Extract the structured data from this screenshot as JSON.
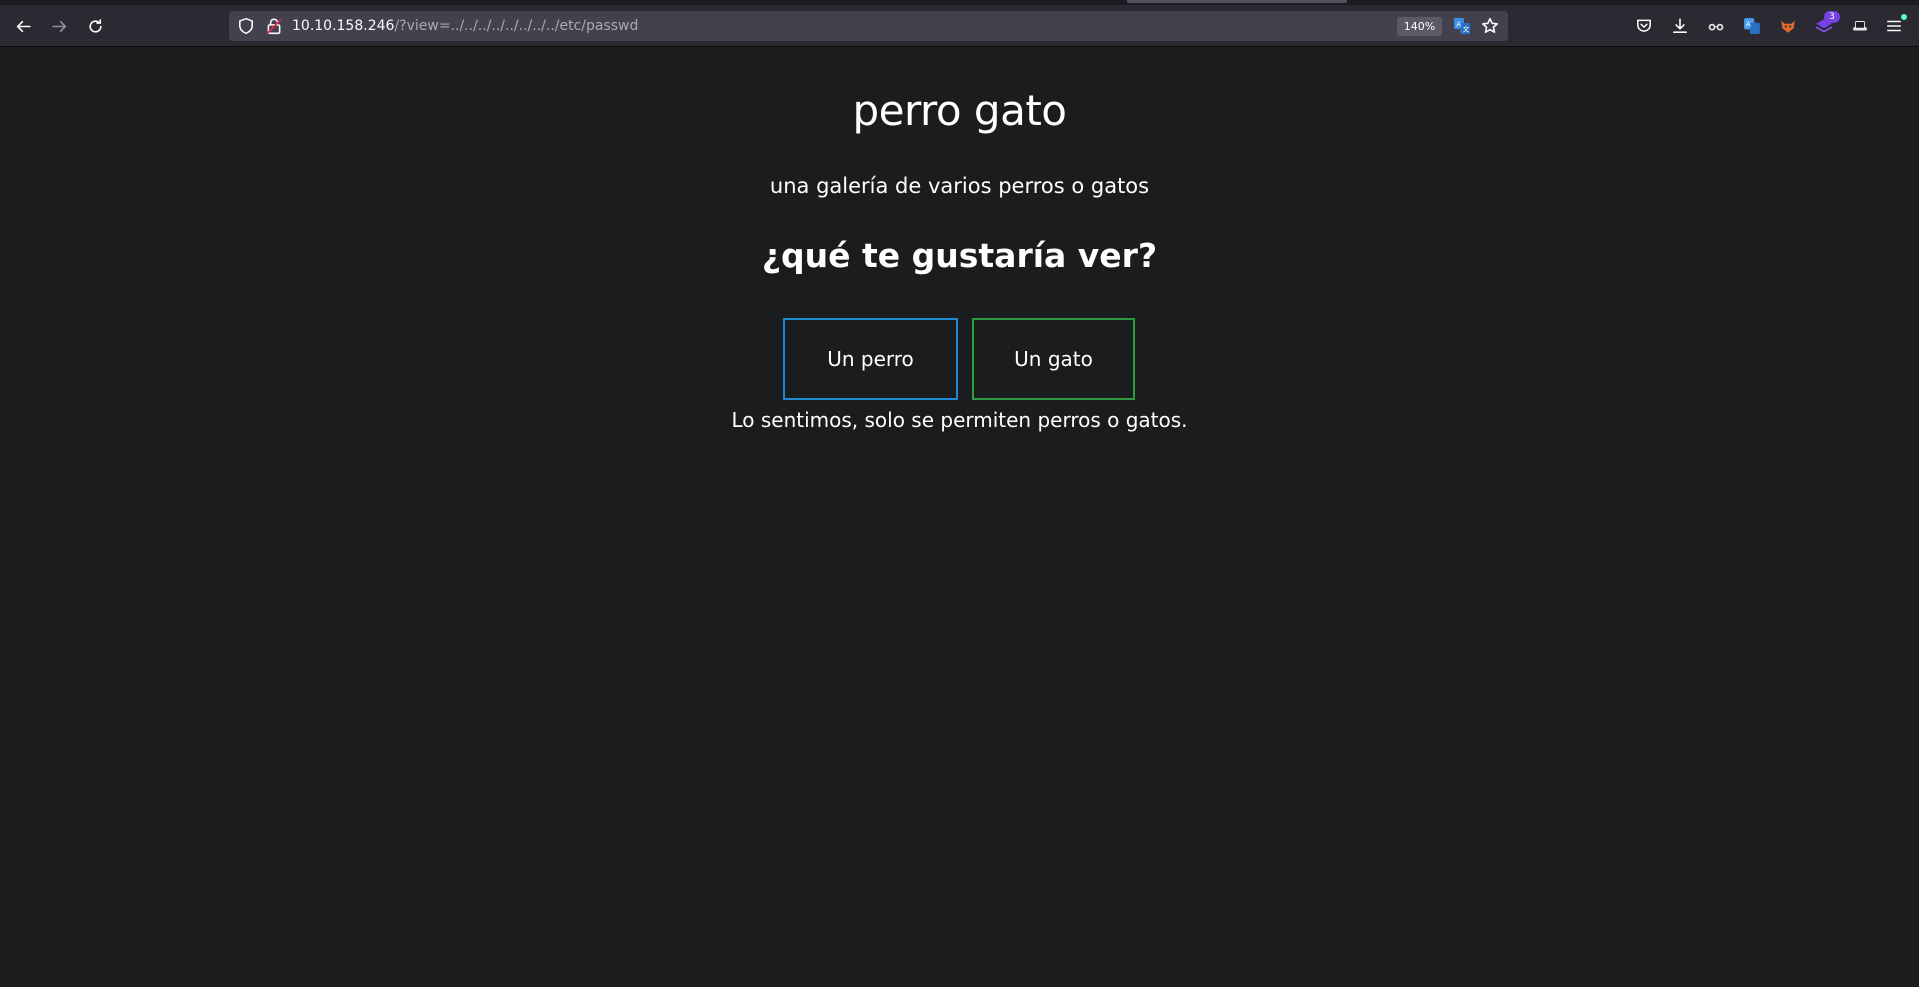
{
  "browser": {
    "url_host": "10.10.158.246",
    "url_path": "/?view=../../../../../../../../etc/passwd",
    "zoom": "140%",
    "extension_badge": "3"
  },
  "page": {
    "title": "perro gato",
    "subtitle": "una galería de varios perros o gatos",
    "question": "¿qué te gustaría ver?",
    "dog_button": "Un perro",
    "cat_button": "Un gato",
    "message": "Lo sentimos, solo se permiten perros o gatos."
  },
  "colors": {
    "page_background": "#1b1c1e",
    "dog_border": "#1f8ad1",
    "cat_border": "#2c9a3f"
  }
}
